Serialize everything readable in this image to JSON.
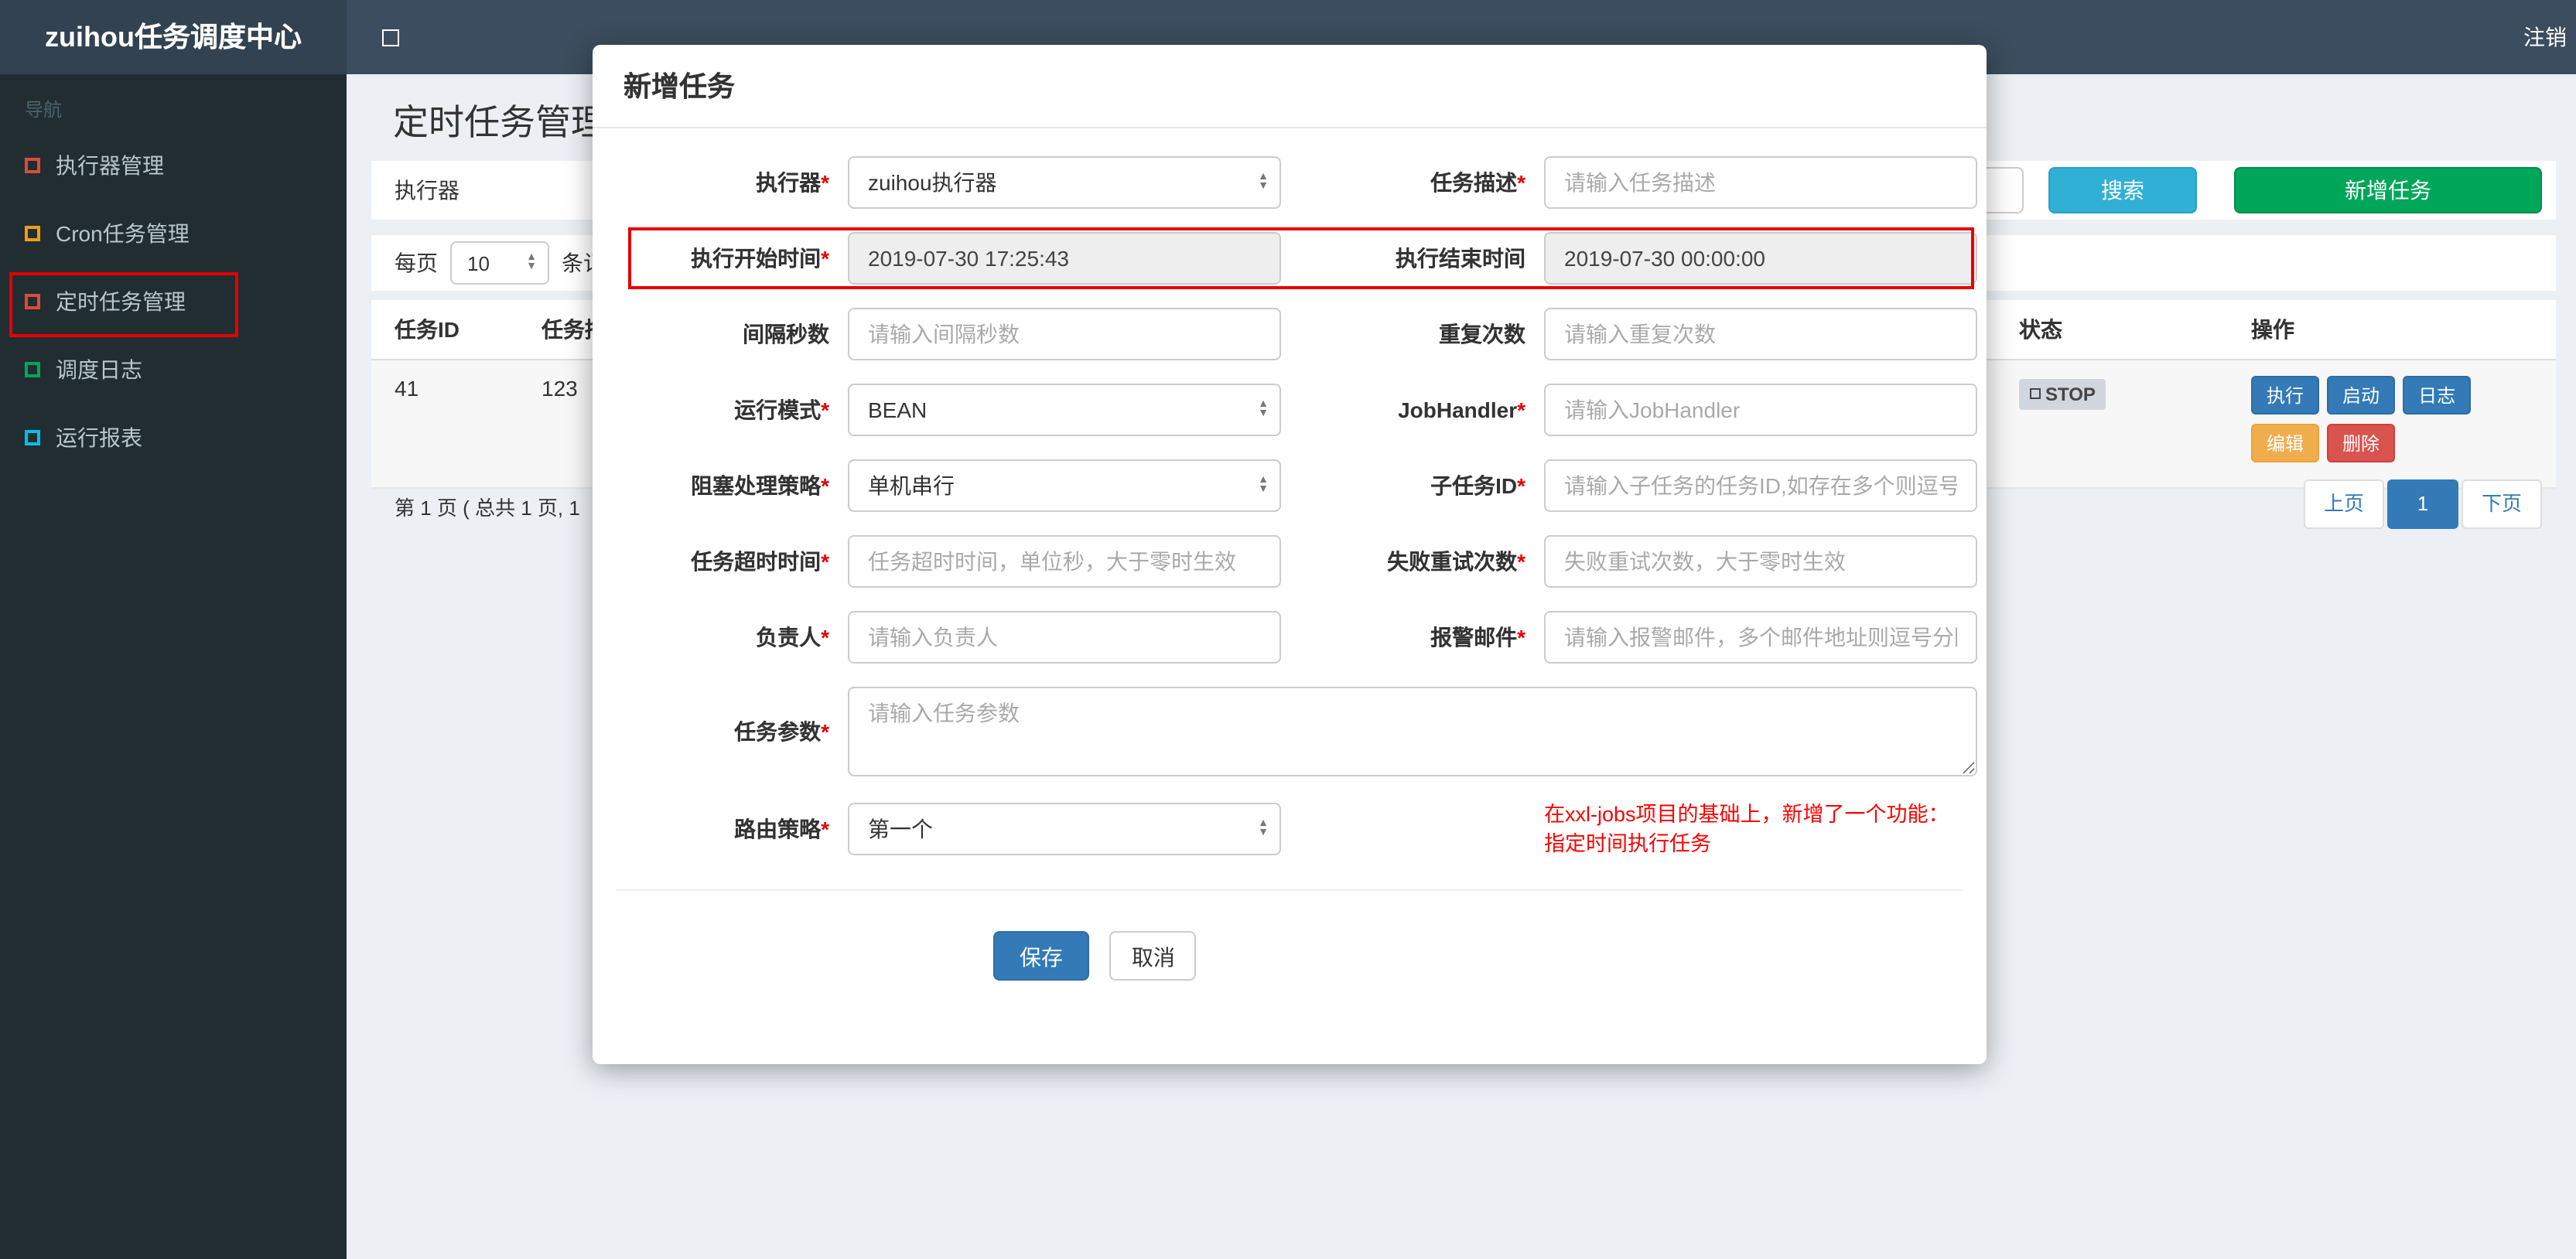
{
  "theme": {
    "navbar_bg": "#3b4d5e",
    "brand_bg": "#334250",
    "sidebar_bg": "#222d32",
    "content_bg": "#ecf0f5",
    "primary_blue": "#337ab7",
    "search_button_color": "#31b0d5",
    "add_button_color": "#00a65a",
    "edit_button_color": "#f0ad4e",
    "delete_button_color": "#d9534f",
    "annotation_red": "#e60000"
  },
  "navbar": {
    "brand": "zuihou任务调度中心",
    "logout": "注销"
  },
  "sidebar": {
    "section_label": "导航",
    "items": [
      {
        "label": "执行器管理",
        "icon_color": "#dd4b39"
      },
      {
        "label": "Cron任务管理",
        "icon_color": "#f39c12"
      },
      {
        "label": "定时任务管理",
        "icon_color": "#dd4b39"
      },
      {
        "label": "调度日志",
        "icon_color": "#00a65a"
      },
      {
        "label": "运行报表",
        "icon_color": "#00c0ef"
      }
    ]
  },
  "page": {
    "title": "定时任务管理",
    "filter": {
      "executor_label": "执行器",
      "search_button": "搜索",
      "add_button": "新增任务"
    },
    "page_size": {
      "prefix": "每页",
      "selected": "10",
      "suffix": "条记录"
    },
    "table": {
      "headers": {
        "id": "任务ID",
        "desc": "任务描述",
        "status": "状态",
        "actions": "操作"
      },
      "row": {
        "id": "41",
        "desc": "123",
        "status_label": "STOP",
        "actions": {
          "run": "执行",
          "start": "启动",
          "log": "日志",
          "edit": "编辑",
          "delete": "删除"
        }
      }
    },
    "pagination": {
      "summary": "第 1 页 ( 总共 1 页, 1",
      "prev": "上页",
      "page": "1",
      "next": "下页"
    }
  },
  "modal": {
    "title": "新增任务",
    "fields": {
      "executor": {
        "label": "执行器",
        "star": "*",
        "value": "zuihou执行器"
      },
      "job_desc": {
        "label": "任务描述",
        "star": "*",
        "placeholder": "请输入任务描述"
      },
      "start_time": {
        "label": "执行开始时间",
        "star": "*",
        "value": "2019-07-30 17:25:43"
      },
      "end_time": {
        "label": "执行结束时间",
        "star": "",
        "value": "2019-07-30 00:00:00"
      },
      "interval": {
        "label": "间隔秒数",
        "star": "",
        "placeholder": "请输入间隔秒数"
      },
      "repeat_count": {
        "label": "重复次数",
        "star": "",
        "placeholder": "请输入重复次数"
      },
      "glue_type": {
        "label": "运行模式",
        "star": "*",
        "value": "BEAN"
      },
      "job_handler": {
        "label": "JobHandler",
        "star": "*",
        "placeholder": "请输入JobHandler"
      },
      "block_strategy": {
        "label": "阻塞处理策略",
        "star": "*",
        "value": "单机串行"
      },
      "child_job": {
        "label": "子任务ID",
        "star": "*",
        "placeholder": "请输入子任务的任务ID,如存在多个则逗号分隔"
      },
      "timeout": {
        "label": "任务超时时间",
        "star": "*",
        "placeholder": "任务超时时间，单位秒，大于零时生效"
      },
      "fail_retry": {
        "label": "失败重试次数",
        "star": "*",
        "placeholder": "失败重试次数，大于零时生效"
      },
      "owner": {
        "label": "负责人",
        "star": "*",
        "placeholder": "请输入负责人"
      },
      "alarm_email": {
        "label": "报警邮件",
        "star": "*",
        "placeholder": "请输入报警邮件，多个邮件地址则逗号分隔"
      },
      "job_param": {
        "label": "任务参数",
        "star": "*",
        "placeholder": "请输入任务参数"
      },
      "route_strategy": {
        "label": "路由策略",
        "star": "*",
        "value": "第一个"
      }
    },
    "note_line1": "在xxl-jobs项目的基础上，新增了一个功能：",
    "note_line2": "指定时间执行任务",
    "save_button": "保存",
    "cancel_button": "取消"
  }
}
